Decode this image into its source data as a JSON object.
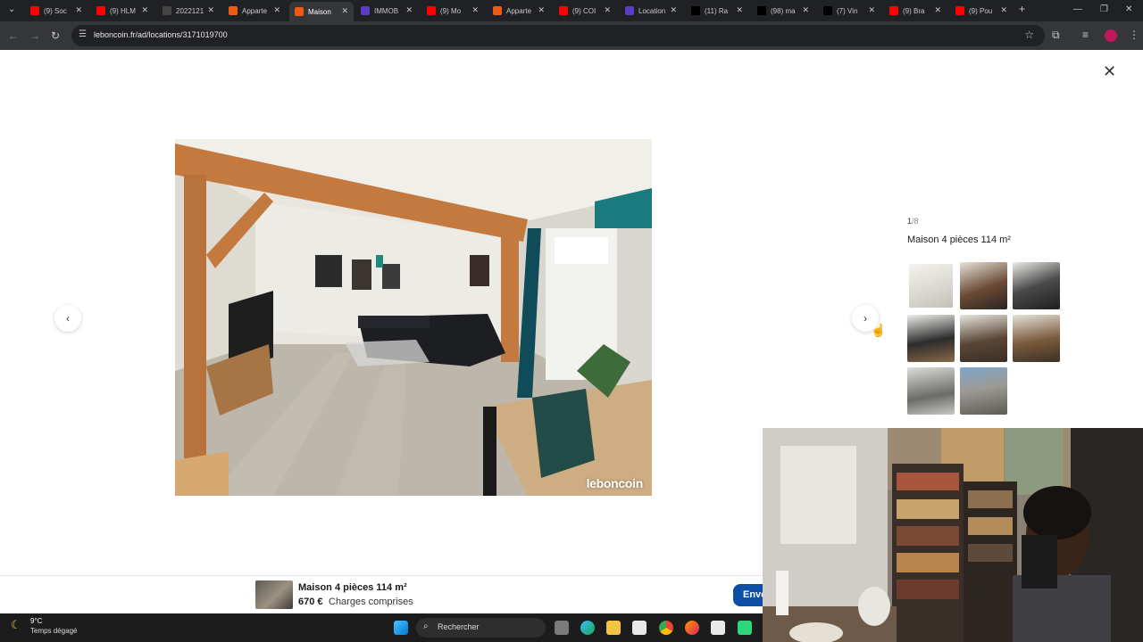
{
  "browser": {
    "tabs": [
      {
        "label": "(9) Soc",
        "color": "#ff0000"
      },
      {
        "label": "(9) HLM",
        "color": "#ff0000"
      },
      {
        "label": "2022121",
        "color": "#444444"
      },
      {
        "label": "Apparte",
        "color": "#ec5a13"
      },
      {
        "label": "Maison",
        "color": "#ec5a13",
        "active": true
      },
      {
        "label": "IMMOB",
        "color": "#5b3cc4"
      },
      {
        "label": "(9) Mo",
        "color": "#ff0000"
      },
      {
        "label": "Apparte",
        "color": "#ec5a13"
      },
      {
        "label": "(9) COI",
        "color": "#ff0000"
      },
      {
        "label": "Location",
        "color": "#5b3cc4"
      },
      {
        "label": "(11) Ra",
        "color": "#000000"
      },
      {
        "label": "(98) ma",
        "color": "#000000"
      },
      {
        "label": "(7) Vin",
        "color": "#000000"
      },
      {
        "label": "(9) Bra",
        "color": "#ff0000"
      },
      {
        "label": "(9) Pou",
        "color": "#ff0000"
      }
    ],
    "url": "leboncoin.fr/ad/locations/3171019700"
  },
  "gallery": {
    "counter_current": "1",
    "counter_total": "/8",
    "title": "Maison 4 pièces 114 m²",
    "watermark": "leboncoin"
  },
  "sticky": {
    "title": "Maison 4 pièces 114 m²",
    "price": "670 €",
    "charges": "Charges comprises",
    "button": "Envo"
  },
  "taskbar": {
    "temp": "9°C",
    "weather": "Temps dégagé",
    "search": "Rechercher"
  },
  "icons": [
    "close-icon",
    "chevron-left-icon",
    "chevron-right-icon",
    "star-icon",
    "cursor-icon",
    "moon-icon",
    "windows-icon",
    "search-icon"
  ]
}
